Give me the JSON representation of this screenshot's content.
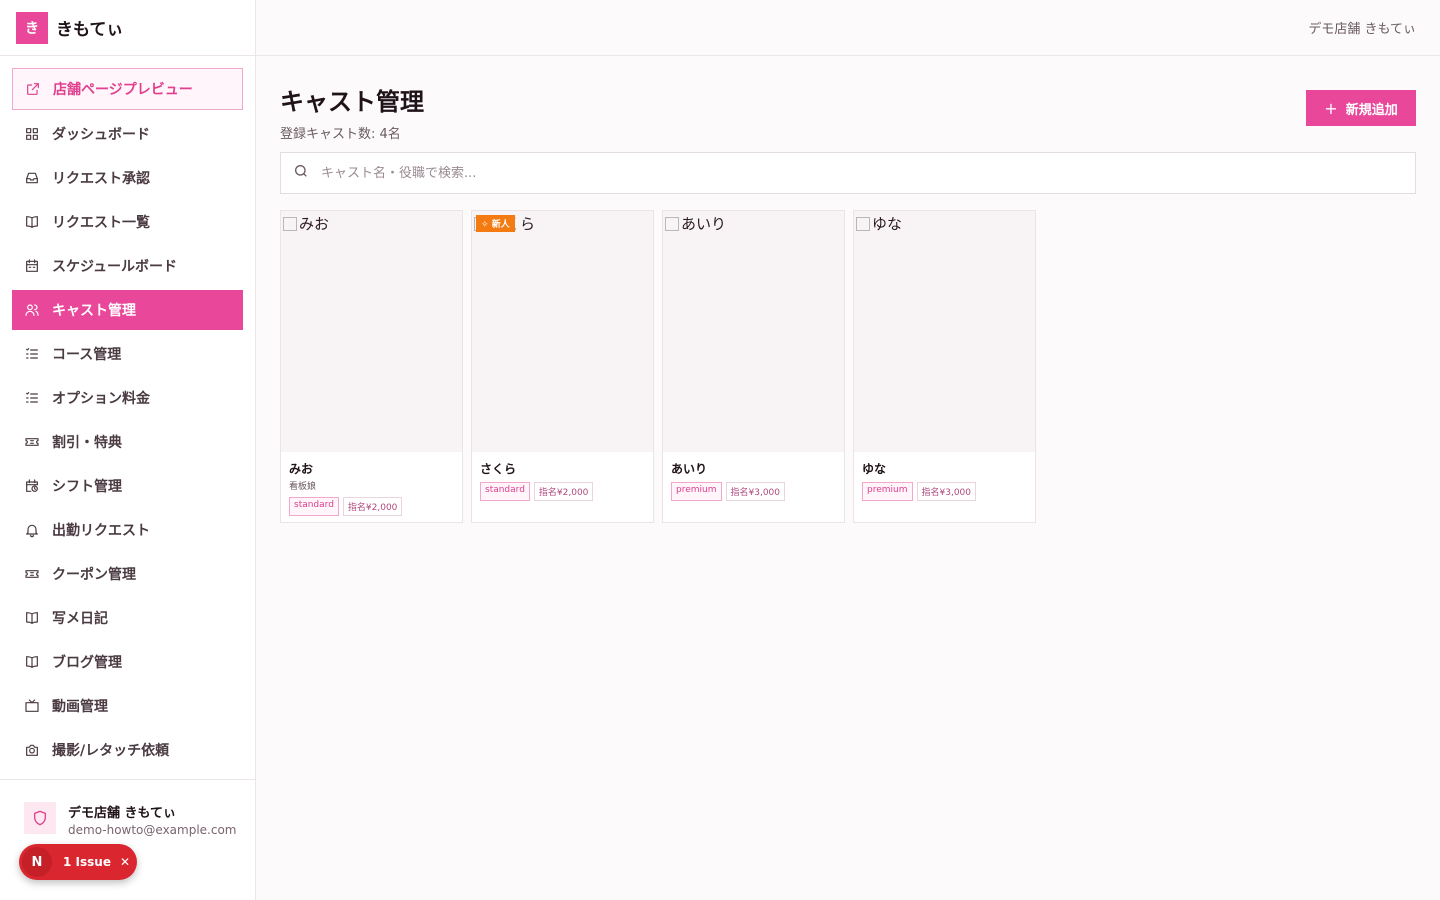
{
  "brand": {
    "logo": "き",
    "name": "きもてぃ"
  },
  "topbar": {
    "store": "デモ店舗 きもてぃ"
  },
  "sidebar": {
    "items": [
      {
        "label": "店舗ページプレビュー",
        "icon": "external-link-icon"
      },
      {
        "label": "ダッシュボード",
        "icon": "grid-icon"
      },
      {
        "label": "リクエスト承認",
        "icon": "inbox-icon"
      },
      {
        "label": "リクエスト一覧",
        "icon": "book-icon"
      },
      {
        "label": "スケジュールボード",
        "icon": "calendar-icon"
      },
      {
        "label": "キャスト管理",
        "icon": "users-icon"
      },
      {
        "label": "コース管理",
        "icon": "list-icon"
      },
      {
        "label": "オプション料金",
        "icon": "list-icon"
      },
      {
        "label": "割引・特典",
        "icon": "ticket-icon"
      },
      {
        "label": "シフト管理",
        "icon": "calendar-clock-icon"
      },
      {
        "label": "出勤リクエスト",
        "icon": "bell-icon"
      },
      {
        "label": "クーポン管理",
        "icon": "ticket-icon"
      },
      {
        "label": "写メ日記",
        "icon": "book-icon"
      },
      {
        "label": "ブログ管理",
        "icon": "book-icon"
      },
      {
        "label": "動画管理",
        "icon": "tv-icon"
      },
      {
        "label": "撮影/レタッチ依頼",
        "icon": "camera-icon"
      }
    ]
  },
  "user": {
    "name": "デモ店舗 きもてぃ",
    "email": "demo-howto@example.com"
  },
  "issue": {
    "initial": "N",
    "label": "1 Issue",
    "close": "✕"
  },
  "page": {
    "title": "キャスト管理",
    "subtitle": "登録キャスト数: 4名",
    "add_label": "新規追加",
    "search_placeholder": "キャスト名・役職で検索..."
  },
  "casts": [
    {
      "alt": "みお",
      "name": "みお",
      "role": "看板娘",
      "tags": [
        "standard",
        "指名¥2,000"
      ],
      "badge": ""
    },
    {
      "alt": "さくら",
      "name": "さくら",
      "role": "",
      "tags": [
        "standard",
        "指名¥2,000"
      ],
      "badge": "新人"
    },
    {
      "alt": "あいり",
      "name": "あいり",
      "role": "",
      "tags": [
        "premium",
        "指名¥3,000"
      ],
      "badge": ""
    },
    {
      "alt": "ゆな",
      "name": "ゆな",
      "role": "",
      "tags": [
        "premium",
        "指名¥3,000"
      ],
      "badge": ""
    }
  ],
  "colors": {
    "accent": "#e8479a",
    "badge": "#f47a12",
    "issue": "#d9262f"
  }
}
